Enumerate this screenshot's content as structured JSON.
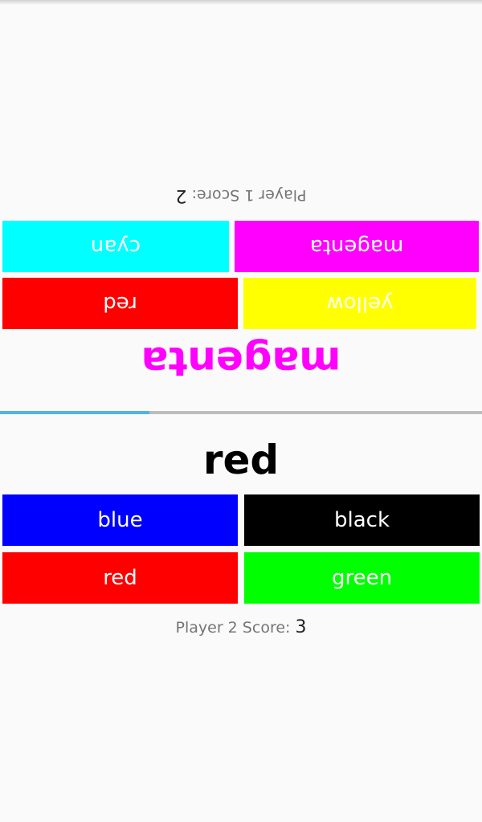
{
  "player1": {
    "target_word": "magenta",
    "target_color": "#ff00ff",
    "buttons": [
      {
        "label": "yellow",
        "color": "#ffff00"
      },
      {
        "label": "red",
        "color": "#ff0000"
      },
      {
        "label": "magenta",
        "color": "#ff00ff"
      },
      {
        "label": "cyan",
        "color": "#00ffff"
      }
    ],
    "score_label": "Player 1 Score:",
    "score_value": "2"
  },
  "player2": {
    "target_word": "red",
    "target_color": "#000000",
    "buttons": [
      {
        "label": "blue",
        "color": "#0000ff"
      },
      {
        "label": "black",
        "color": "#000000"
      },
      {
        "label": "red",
        "color": "#ff0000"
      },
      {
        "label": "green",
        "color": "#00ff00"
      }
    ],
    "score_label": "Player 2 Score:",
    "score_value": "3"
  },
  "timer": {
    "progress": 0.31,
    "fill_color": "#4fb4e4",
    "track_color": "#bdbdbd"
  }
}
